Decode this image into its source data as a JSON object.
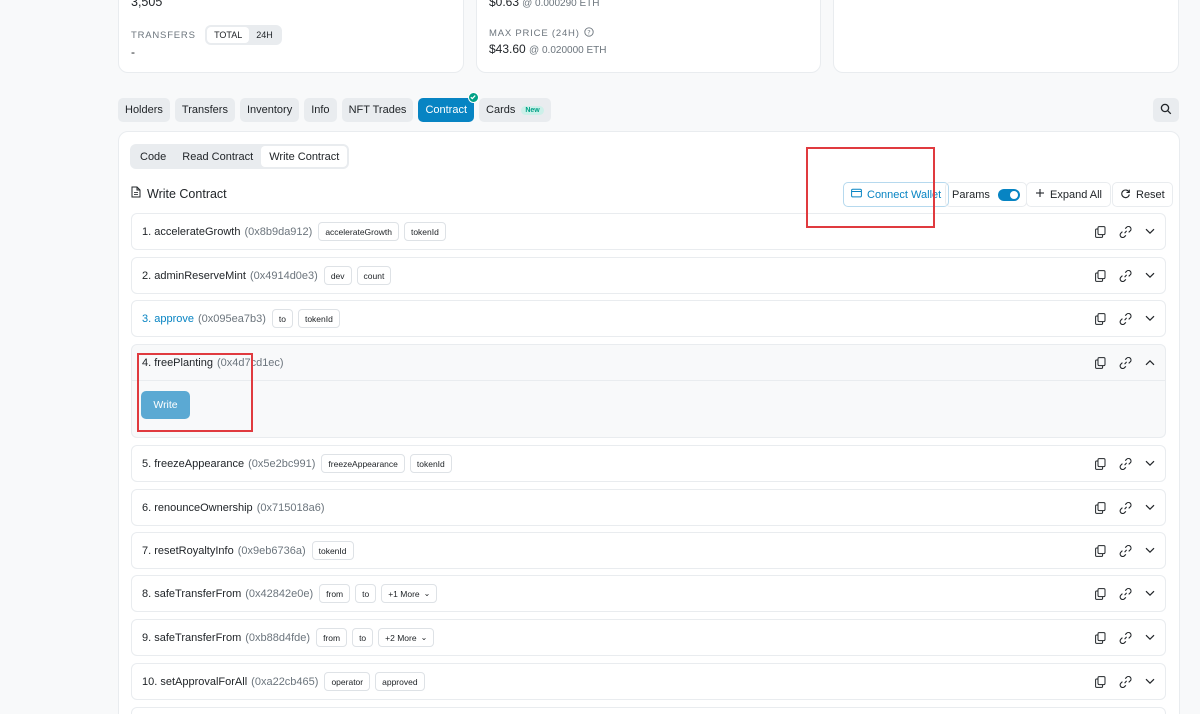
{
  "stats": {
    "holders_value": "3,505",
    "transfers_label": "TRANSFERS",
    "transfers_seg": [
      "TOTAL",
      "24H"
    ],
    "transfers_value": "-",
    "min_price_value": "$0.63",
    "min_price_eth": "@ 0.000290 ETH",
    "max_price_label": "MAX PRICE (24H)",
    "max_price_value": "$43.60",
    "max_price_eth": "@ 0.020000 ETH"
  },
  "tabs": [
    {
      "label": "Holders"
    },
    {
      "label": "Transfers"
    },
    {
      "label": "Inventory"
    },
    {
      "label": "Info"
    },
    {
      "label": "NFT Trades"
    },
    {
      "label": "Contract"
    },
    {
      "label": "Cards",
      "badge": "New"
    }
  ],
  "active_tab": "Contract",
  "subtabs": [
    "Code",
    "Read Contract",
    "Write Contract"
  ],
  "active_subtab": "Write Contract",
  "section_title": "Write Contract",
  "toolbar": {
    "connect_wallet": "Connect Wallet",
    "params": "Params",
    "params_on": true,
    "expand_all": "Expand All",
    "reset": "Reset"
  },
  "functions": [
    {
      "name": "1. accelerateGrowth",
      "sig": "(0x8b9da912)",
      "params": [
        "accelerateGrowth",
        "tokenId"
      ]
    },
    {
      "name": "2. adminReserveMint",
      "sig": "(0x4914d0e3)",
      "params": [
        "dev",
        "count"
      ]
    },
    {
      "name": "3. approve",
      "sig": "(0x095ea7b3)",
      "params": [
        "to",
        "tokenId"
      ]
    },
    {
      "name": "4. freePlanting",
      "sig": "(0x4d7cd1ec)",
      "params": []
    },
    {
      "name": "5. freezeAppearance",
      "sig": "(0x5e2bc991)",
      "params": [
        "freezeAppearance",
        "tokenId"
      ]
    },
    {
      "name": "6. renounceOwnership",
      "sig": "(0x715018a6)",
      "params": []
    },
    {
      "name": "7. resetRoyaltyInfo",
      "sig": "(0x9eb6736a)",
      "params": [
        "tokenId"
      ]
    },
    {
      "name": "8. safeTransferFrom",
      "sig": "(0x42842e0e)",
      "params": [
        "from",
        "to",
        "+1 More"
      ]
    },
    {
      "name": "9. safeTransferFrom",
      "sig": "(0xb88d4fde)",
      "params": [
        "from",
        "to",
        "+2 More"
      ]
    },
    {
      "name": "10. setApprovalForAll",
      "sig": "(0xa22cb465)",
      "params": [
        "operator",
        "approved"
      ]
    }
  ],
  "expanded_function": "4. freePlanting",
  "write_button": "Write",
  "colors": {
    "accent": "#0784c3",
    "success": "#00a186",
    "highlight": "#e03a3f"
  }
}
